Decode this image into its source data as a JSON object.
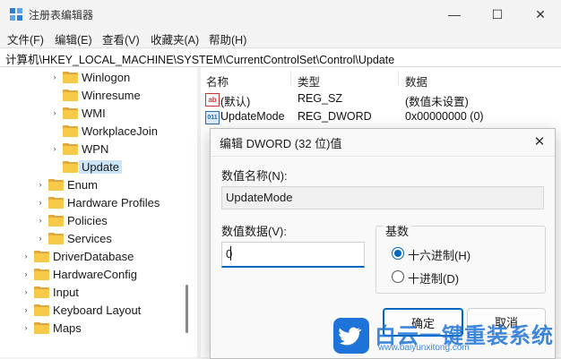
{
  "window": {
    "title": "注册表编辑器",
    "min": "—",
    "max": "☐",
    "close": "✕"
  },
  "menu": [
    "文件(F)",
    "编辑(E)",
    "查看(V)",
    "收藏夹(A)",
    "帮助(H)"
  ],
  "address": "计算机\\HKEY_LOCAL_MACHINE\\SYSTEM\\CurrentControlSet\\Control\\Update",
  "tree": [
    {
      "label": "Winlogon",
      "chevron": "›"
    },
    {
      "label": "Winresume",
      "chevron": ""
    },
    {
      "label": "WMI",
      "chevron": "›"
    },
    {
      "label": "WorkplaceJoin",
      "chevron": ""
    },
    {
      "label": "WPN",
      "chevron": "›"
    },
    {
      "label": "Update",
      "chevron": ""
    },
    {
      "label": "Enum",
      "chevron": "›"
    },
    {
      "label": "Hardware Profiles",
      "chevron": "›"
    },
    {
      "label": "Policies",
      "chevron": "›"
    },
    {
      "label": "Services",
      "chevron": "›"
    },
    {
      "label": "DriverDatabase",
      "chevron": "›"
    },
    {
      "label": "HardwareConfig",
      "chevron": "›"
    },
    {
      "label": "Input",
      "chevron": "›"
    },
    {
      "label": "Keyboard Layout",
      "chevron": "›"
    },
    {
      "label": "Maps",
      "chevron": "›"
    }
  ],
  "list": {
    "headers": [
      "名称",
      "类型",
      "数据"
    ],
    "rows": [
      {
        "icon": "ab",
        "name": "(默认)",
        "type": "REG_SZ",
        "data": "(数值未设置)"
      },
      {
        "icon": "011",
        "name": "UpdateMode",
        "type": "REG_DWORD",
        "data": "0x00000000 (0)"
      }
    ]
  },
  "dialog": {
    "title": "编辑 DWORD (32 位)值",
    "name_label": "数值名称(N):",
    "name_value": "UpdateMode",
    "data_label": "数值数据(V):",
    "data_value": "0",
    "base_label": "基数",
    "hex_label": "十六进制(H)",
    "dec_label": "十进制(D)",
    "selected_base": "hex",
    "ok": "确定",
    "cancel": "取消"
  },
  "watermark": {
    "text": "白云一键重装系统",
    "url": "www.baiyunxitong.com"
  }
}
